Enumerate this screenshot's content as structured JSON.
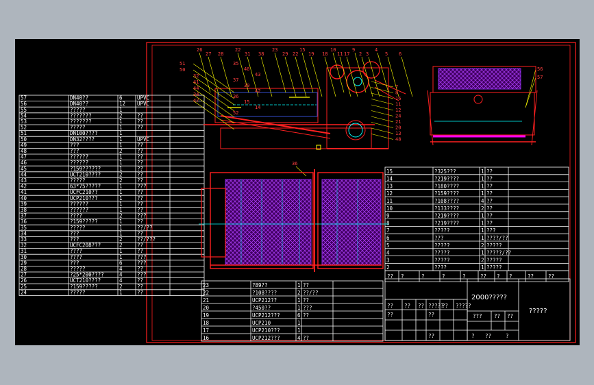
{
  "colors": {
    "background": "#aeb5bd",
    "sheet": "#000000",
    "frame": "#ff2020",
    "grid": "#ffffff",
    "part": "#ff2020",
    "mesh": "#8a2be2",
    "accent": "#00ffff",
    "weld": "#ffff00",
    "label": "#ff4040"
  },
  "bom_left": [
    {
      "no": "57",
      "name": "DN40??",
      "qty": "6",
      "mat": "UPVC"
    },
    {
      "no": "56",
      "name": "DN40??",
      "qty": "12",
      "mat": "UPVC"
    },
    {
      "no": "55",
      "name": "?????",
      "qty": "1",
      "mat": ""
    },
    {
      "no": "54",
      "name": "???????",
      "qty": "2",
      "mat": "??"
    },
    {
      "no": "53",
      "name": "???????",
      "qty": "1",
      "mat": "??"
    },
    {
      "no": "52",
      "name": "?????",
      "qty": "1",
      "mat": "??"
    },
    {
      "no": "51",
      "name": "DN100????",
      "qty": "1",
      "mat": ""
    },
    {
      "no": "50",
      "name": "DN32????",
      "qty": "1",
      "mat": "UPVC"
    },
    {
      "no": "49",
      "name": "???",
      "qty": "1",
      "mat": "??"
    },
    {
      "no": "48",
      "name": "???",
      "qty": "2",
      "mat": "??"
    },
    {
      "no": "47",
      "name": "??????",
      "qty": "1",
      "mat": "??"
    },
    {
      "no": "46",
      "name": "??????",
      "qty": "1",
      "mat": "??"
    },
    {
      "no": "45",
      "name": "?159??????",
      "qty": "1",
      "mat": "??"
    },
    {
      "no": "44",
      "name": "UCT210????",
      "qty": "2",
      "mat": "??"
    },
    {
      "no": "43",
      "name": "?????",
      "qty": "2",
      "mat": "??"
    },
    {
      "no": "42",
      "name": "63*75?????",
      "qty": "1",
      "mat": "???"
    },
    {
      "no": "41",
      "name": "UCFC210??",
      "qty": "1",
      "mat": "??"
    },
    {
      "no": "40",
      "name": "UCP210???",
      "qty": "1",
      "mat": "??"
    },
    {
      "no": "39",
      "name": "??????",
      "qty": "1",
      "mat": "??"
    },
    {
      "no": "38",
      "name": "??????",
      "qty": "1",
      "mat": "??"
    },
    {
      "no": "37",
      "name": "????",
      "qty": "2",
      "mat": "???"
    },
    {
      "no": "36",
      "name": "?159?????",
      "qty": "1",
      "mat": "??"
    },
    {
      "no": "35",
      "name": "?????",
      "qty": "1",
      "mat": "??/??"
    },
    {
      "no": "34",
      "name": "???",
      "qty": "1",
      "mat": "??"
    },
    {
      "no": "33",
      "name": "???",
      "qty": "2",
      "mat": "??/???"
    },
    {
      "no": "32",
      "name": "UCFC208???",
      "qty": "2",
      "mat": "??"
    },
    {
      "no": "31",
      "name": "????",
      "qty": "1",
      "mat": "??"
    },
    {
      "no": "30",
      "name": "????",
      "qty": "1",
      "mat": "???"
    },
    {
      "no": "29",
      "name": "???",
      "qty": "6",
      "mat": "???"
    },
    {
      "no": "28",
      "name": "?????",
      "qty": "4",
      "mat": "??"
    },
    {
      "no": "27",
      "name": "?25*200????",
      "qty": "4",
      "mat": "???"
    },
    {
      "no": "26",
      "name": "UCT210????",
      "qty": "4",
      "mat": "??"
    },
    {
      "no": "25",
      "name": "?159?????",
      "qty": "2",
      "mat": "??"
    },
    {
      "no": "24",
      "name": "?????",
      "qty": "1",
      "mat": "??"
    }
  ],
  "bom_mid": [
    {
      "no": "23",
      "name": "?89??",
      "qty": "1",
      "mat": "??"
    },
    {
      "no": "22",
      "name": "?108????",
      "qty": "2",
      "mat": "??/??"
    },
    {
      "no": "21",
      "name": "UCP212??",
      "qty": "1",
      "mat": "??"
    },
    {
      "no": "20",
      "name": "?450??",
      "qty": "1",
      "mat": "???"
    },
    {
      "no": "19",
      "name": "UCP212???",
      "qty": "6",
      "mat": "??"
    },
    {
      "no": "18",
      "name": "UCP210",
      "qty": "1",
      "mat": ""
    },
    {
      "no": "17",
      "name": "UCP210???",
      "qty": "1",
      "mat": ""
    },
    {
      "no": "16",
      "name": "UCP212???",
      "qty": "4",
      "mat": "??"
    }
  ],
  "bom_right": [
    {
      "no": "15",
      "name": "?325???",
      "qty": "1",
      "mat": "??"
    },
    {
      "no": "14",
      "name": "?219????",
      "qty": "1",
      "mat": "??"
    },
    {
      "no": "13",
      "name": "?180????",
      "qty": "1",
      "mat": "??"
    },
    {
      "no": "12",
      "name": "?159????",
      "qty": "1",
      "mat": "??"
    },
    {
      "no": "11",
      "name": "?108????",
      "qty": "4",
      "mat": "??"
    },
    {
      "no": "10",
      "name": "?133????",
      "qty": "2",
      "mat": "??"
    },
    {
      "no": "9",
      "name": "?219????",
      "qty": "1",
      "mat": "??"
    },
    {
      "no": "8",
      "name": "?219????",
      "qty": "1",
      "mat": "??"
    },
    {
      "no": "7",
      "name": "?????",
      "qty": "1",
      "mat": "???"
    },
    {
      "no": "6",
      "name": "???",
      "qty": "1",
      "mat": "????/??"
    },
    {
      "no": "5",
      "name": "?????",
      "qty": "2",
      "mat": "?????"
    },
    {
      "no": "4",
      "name": "?????",
      "qty": "1",
      "mat": "?????/??"
    },
    {
      "no": "3",
      "name": "?????",
      "qty": "2",
      "mat": "?????"
    },
    {
      "no": "2",
      "name": "????",
      "qty": "1",
      "mat": "?????"
    }
  ],
  "bom_header": [
    "??",
    "?",
    "?",
    "?",
    "?",
    "??",
    "?",
    "?",
    "??",
    "??"
  ],
  "title_block": {
    "drawing_title": "2000?????",
    "company": "?????",
    "cells": [
      "???",
      "??",
      "??",
      "?",
      "??",
      "?"
    ],
    "row_labels": [
      "??",
      "??",
      "??",
      "?????",
      "??",
      "?????"
    ],
    "row_labels_mid": [
      "??",
      "??",
      "??"
    ]
  },
  "callouts_top": [
    "26",
    "27",
    "28",
    "22",
    "31",
    "38",
    "23",
    "29",
    "22",
    "15",
    "19",
    "18",
    "10",
    "11",
    "17",
    "9",
    "2",
    "3",
    "4",
    "5",
    "6"
  ],
  "callouts_left": [
    "51",
    "50",
    "32",
    "41",
    "44",
    "34",
    "47"
  ],
  "callouts_mid": [
    "35",
    "40",
    "43",
    "37",
    "39",
    "42",
    "36",
    "15",
    "14",
    "52"
  ],
  "callouts_right": [
    "7",
    "8",
    "16",
    "11",
    "12",
    "24",
    "21",
    "20",
    "13",
    "48"
  ],
  "callout_side": [
    "56",
    "57"
  ],
  "callout_plan": "36"
}
